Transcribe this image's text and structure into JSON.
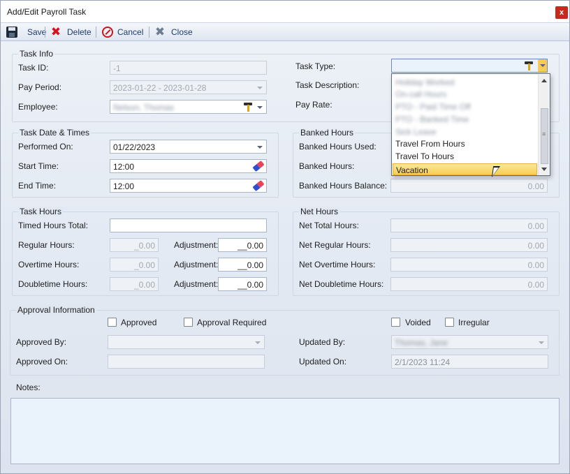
{
  "window": {
    "title": "Add/Edit Payroll Task",
    "close_glyph": "x"
  },
  "toolbar": {
    "save": "Save",
    "delete": "Delete",
    "cancel": "Cancel",
    "close": "Close"
  },
  "task_info": {
    "legend": "Task Info",
    "task_id_label": "Task ID:",
    "task_id_value": "-1",
    "pay_period_label": "Pay Period:",
    "pay_period_value": "2023-01-22 - 2023-01-28",
    "employee_label": "Employee:",
    "employee_value": "Nelson, Thomas",
    "task_type_label": "Task Type:",
    "task_type_value": "",
    "task_description_label": "Task Description:",
    "pay_rate_label": "Pay Rate:"
  },
  "task_type_dropdown": {
    "items_blurred": [
      "Holiday Worked",
      "On-call Hours",
      "PTO - Paid Time Off",
      "PTO - Banked Time",
      "Sick Leave"
    ],
    "items": [
      "Travel From Hours",
      "Travel To Hours"
    ],
    "selected": "Vacation"
  },
  "date_times": {
    "legend": "Task Date & Times",
    "performed_on_label": "Performed On:",
    "performed_on_value": "01/22/2023",
    "start_time_label": "Start Time:",
    "start_time_value": "12:00",
    "end_time_label": "End Time:",
    "end_time_value": "12:00"
  },
  "banked": {
    "legend": "Banked Hours",
    "used_label": "Banked Hours Used:",
    "hours_label": "Banked Hours:",
    "balance_label": "Banked Hours Balance:",
    "balance_value": "0.00"
  },
  "task_hours": {
    "legend": "Task Hours",
    "timed_total_label": "Timed Hours Total:",
    "timed_total_value": "",
    "regular_label": "Regular Hours:",
    "regular_value": "_0.00",
    "overtime_label": "Overtime Hours:",
    "overtime_value": "_0.00",
    "doubletime_label": "Doubletime Hours:",
    "doubletime_value": "_0.00",
    "adjustment_label": "Adjustment:",
    "adjustment_value": "__0.00"
  },
  "net_hours": {
    "legend": "Net Hours",
    "total_label": "Net Total Hours:",
    "total_value": "0.00",
    "regular_label": "Net Regular Hours:",
    "regular_value": "0.00",
    "overtime_label": "Net Overtime Hours:",
    "overtime_value": "0.00",
    "doubletime_label": "Net Doubletime Hours:",
    "doubletime_value": "0.00"
  },
  "approval": {
    "legend": "Approval Information",
    "approved": "Approved",
    "approval_required": "Approval Required",
    "voided": "Voided",
    "irregular": "Irregular",
    "approved_by_label": "Approved By:",
    "approved_by_value": "",
    "approved_on_label": "Approved On:",
    "approved_on_value": "",
    "updated_by_label": "Updated By:",
    "updated_by_value": "Thomas, Jane",
    "updated_on_label": "Updated On:",
    "updated_on_value": "2/1/2023 11:24"
  },
  "notes": {
    "label": "Notes:",
    "value": ""
  },
  "colors": {
    "accent": "#1f3a6b",
    "selection": "#f6cd4f",
    "close_red": "#c42b1c"
  }
}
